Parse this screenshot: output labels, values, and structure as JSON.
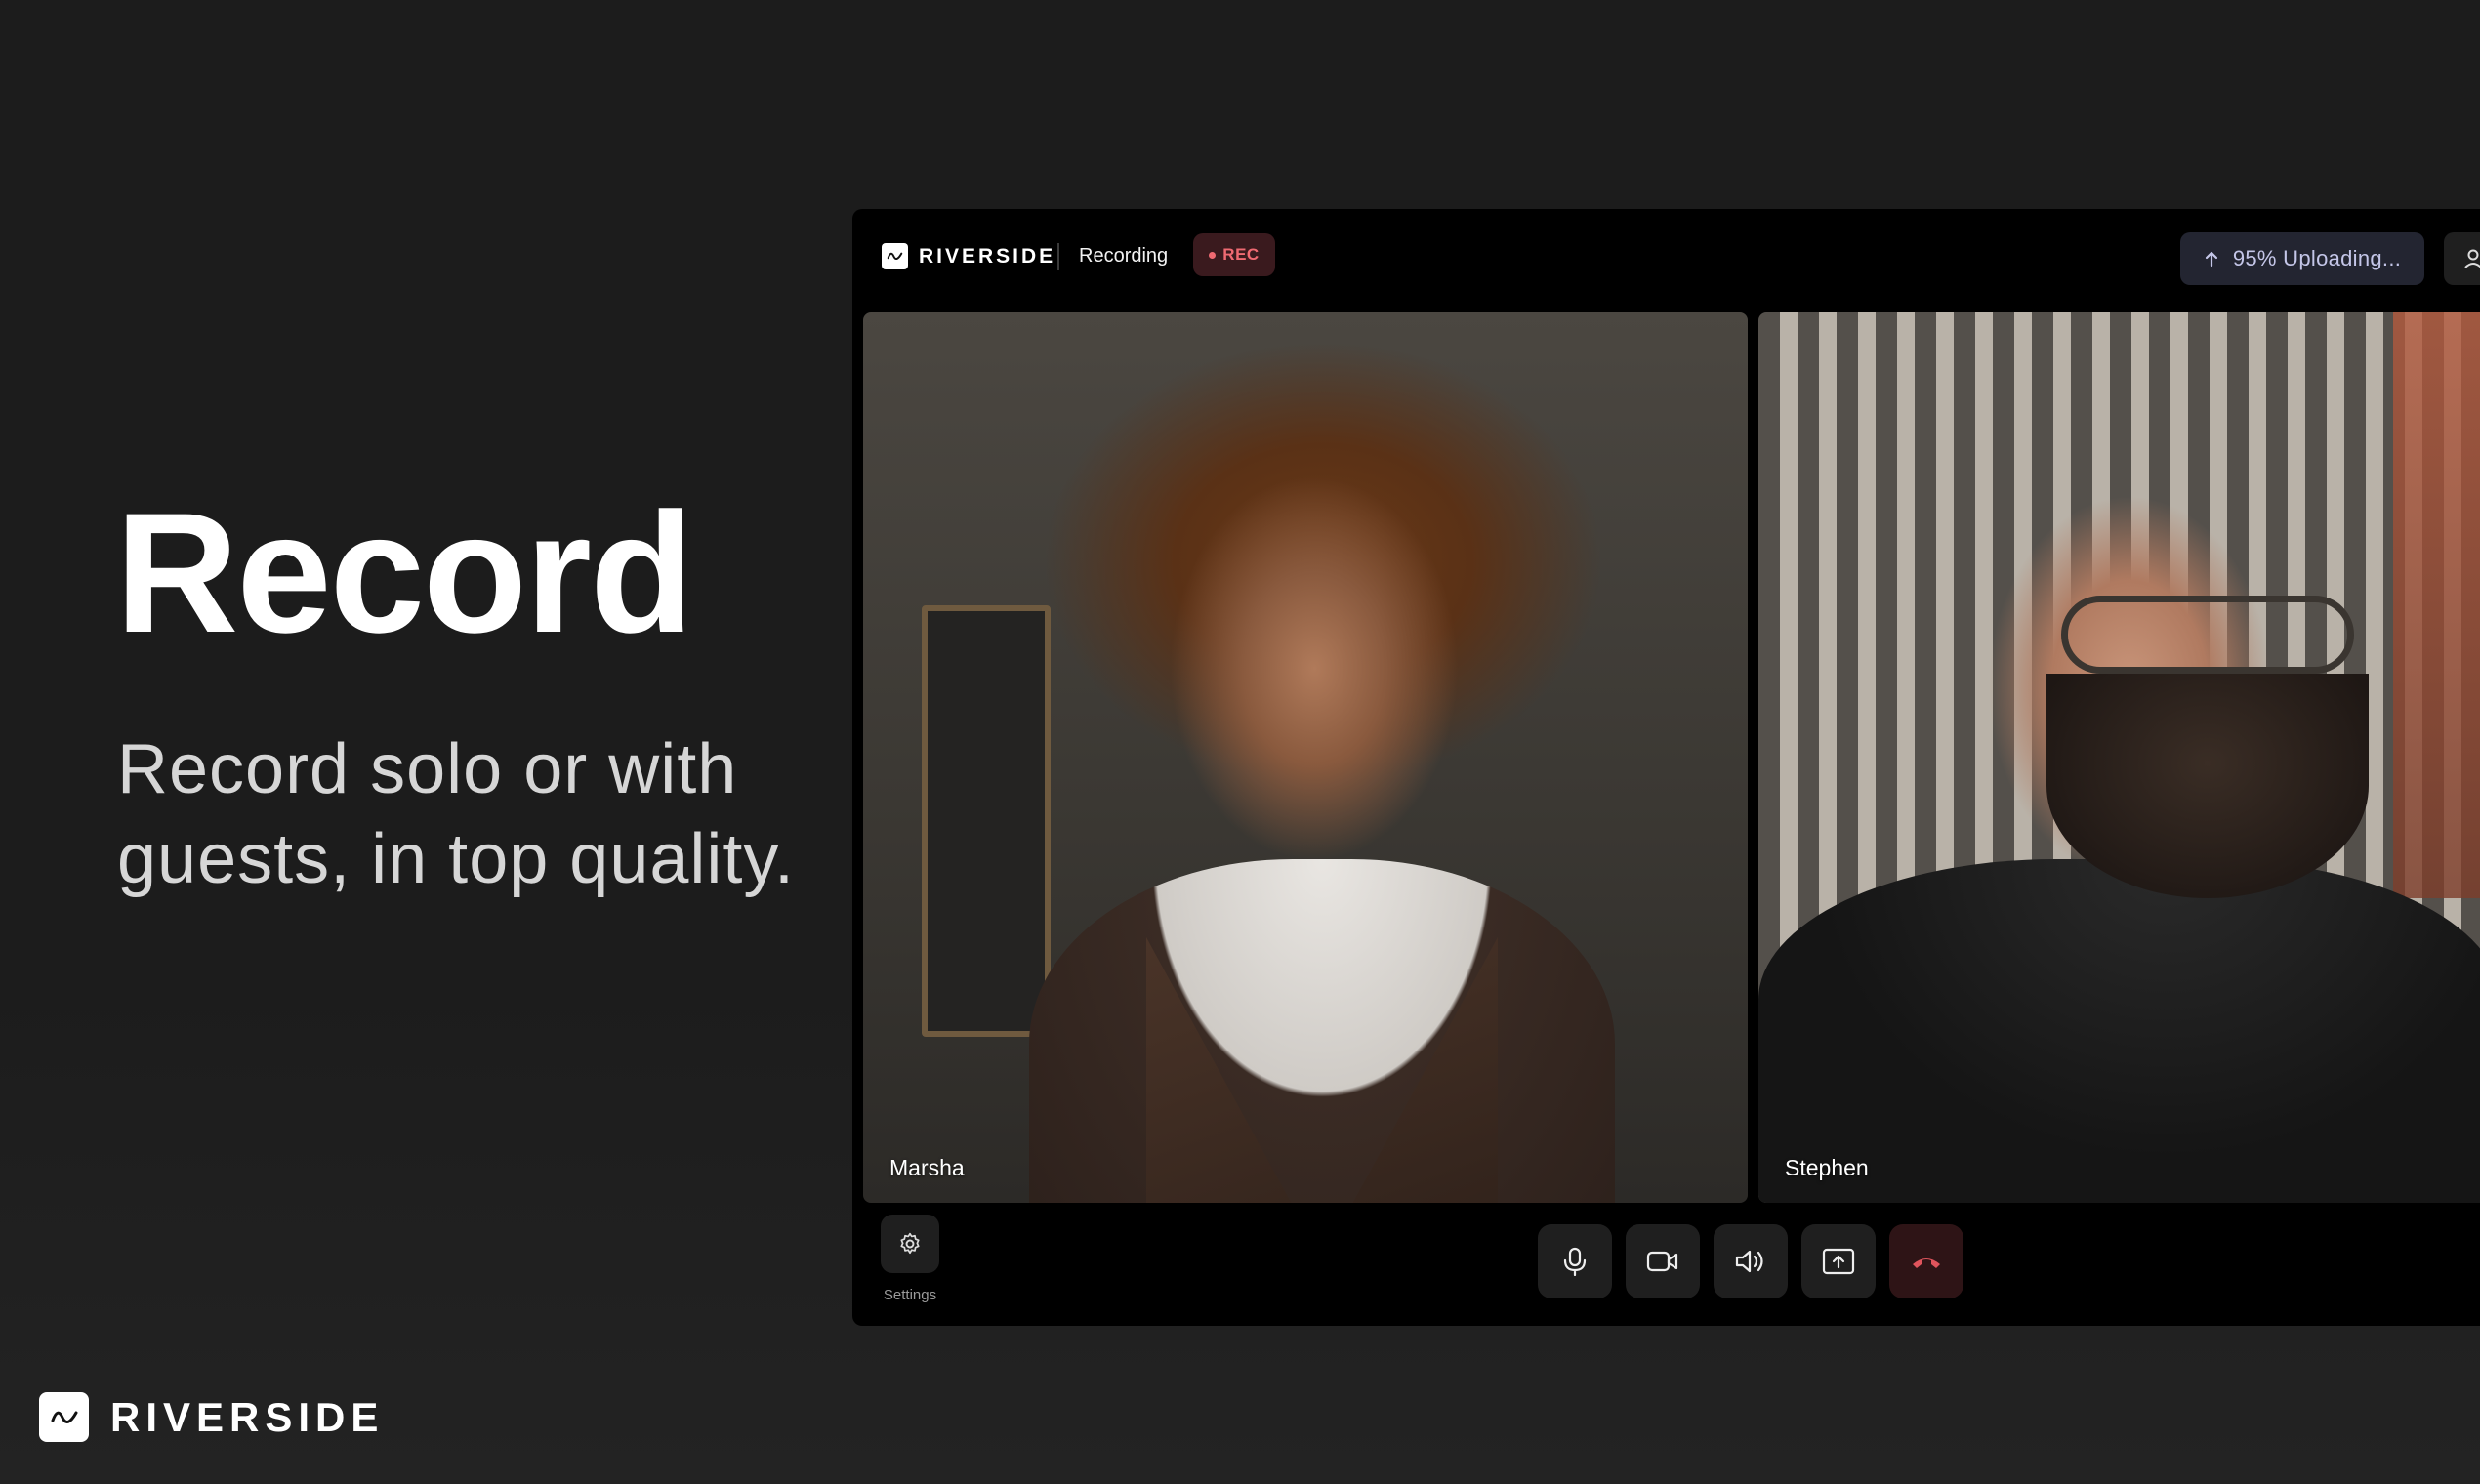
{
  "hero": {
    "title": "Record",
    "subtitle": "Record solo or with guests, in top quality."
  },
  "brand": {
    "name": "RIVERSIDE"
  },
  "app": {
    "brand_name": "RIVERSIDE",
    "status": "Recording",
    "rec_badge": "REC",
    "upload_status": "95% Uploading...",
    "upload_progress_percent": 95,
    "participants": [
      {
        "name": "Marsha"
      },
      {
        "name": "Stephen"
      }
    ],
    "settings_label": "Settings",
    "controls": [
      {
        "icon": "microphone-icon"
      },
      {
        "icon": "camera-icon"
      },
      {
        "icon": "speaker-icon"
      },
      {
        "icon": "share-screen-icon"
      },
      {
        "icon": "end-call-icon"
      }
    ],
    "colors": {
      "rec": "#ef6a72",
      "upload_text": "#c4c6e8",
      "end_call": "#e0545c"
    }
  }
}
